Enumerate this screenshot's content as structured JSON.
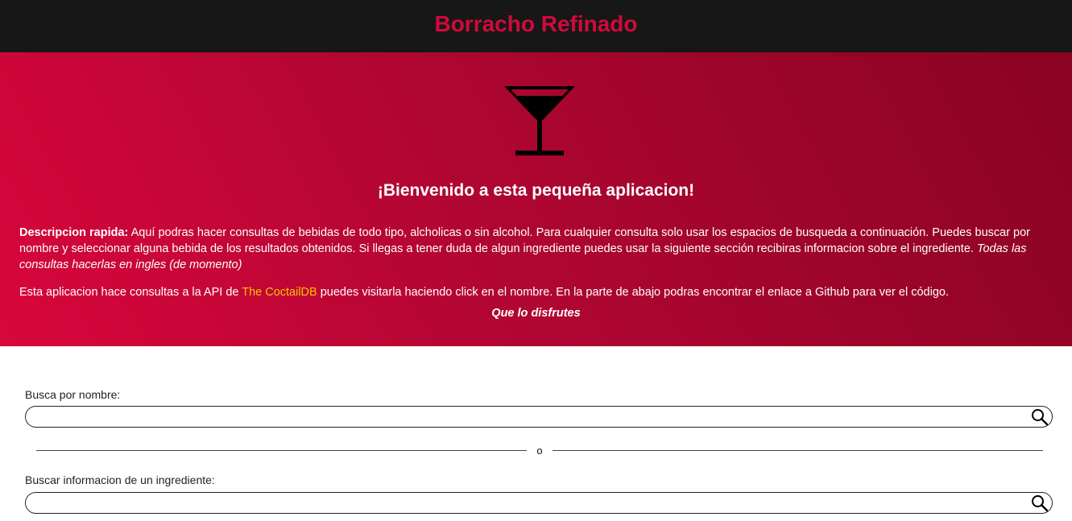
{
  "header": {
    "title": "Borracho Refinado",
    "brand_color": "#d10a3c"
  },
  "hero": {
    "icon": "cocktail-glass-icon",
    "welcome": "¡Bienvenido a esta pequeña aplicacion!",
    "desc_bold": "Descripcion rapida:",
    "desc_text": " Aquí podras hacer consultas de bebidas de todo tipo, alcholicas o sin alcohol. Para cualquier consulta solo usar los espacios de busqueda a continuación. Puedes buscar por nombre y seleccionar alguna bebida de los resultados obtenidos. Si llegas a tener duda de algun ingrediente puedes usar la siguiente sección recibiras informacion sobre el ingrediente. ",
    "desc_italic": "Todas las consultas hacerlas en ingles (de momento)",
    "api_before": "Esta aplicacion hace consultas a la API de ",
    "api_link": "The CoctailDB",
    "api_after": " puedes visitarla haciendo click en el nombre. En la parte de abajo podras encontrar el enlace a Github para ver el código.",
    "enjoy": "Que lo disfrutes",
    "gradient_colors": [
      "#d8063b",
      "#8a0322"
    ],
    "link_color": "#f5c400"
  },
  "search": {
    "name_label": "Busca por nombre:",
    "name_value": "",
    "divider_text": "o",
    "ingredient_label": "Buscar informacion de un ingrediente:",
    "ingredient_value": "",
    "button_icon": "search-icon"
  }
}
